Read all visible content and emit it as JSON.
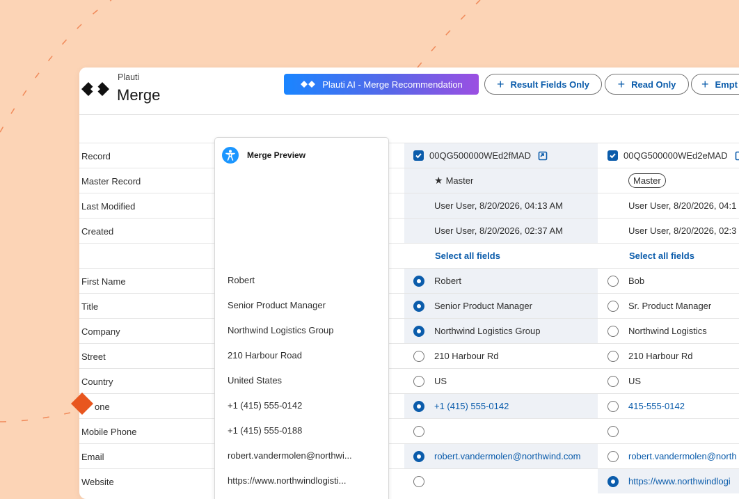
{
  "header": {
    "brand": "Plauti",
    "title": "Merge",
    "ai_button": "Plauti AI - Merge Recommendation",
    "result_fields_button": "Result Fields Only",
    "read_only_button": "Read Only",
    "empty_button": "Empt"
  },
  "preview": {
    "title": "Merge Preview",
    "icon": "accessibility-person-icon",
    "values": {
      "first_name": "Robert",
      "title": "Senior Product Manager",
      "company": "Northwind Logistics Group",
      "street": "210 Harbour Road",
      "country": "United States",
      "phone": "+1 (415) 555-0142",
      "mobile_phone": "+1 (415) 555-0188",
      "email": "robert.vandermolen@northwi...",
      "website": "https://www.northwindlogisti..."
    }
  },
  "labels": {
    "record": "Record",
    "master_record": "Master Record",
    "last_modified": "Last Modified",
    "created": "Created",
    "first_name": "First Name",
    "title": "Title",
    "company": "Company",
    "street": "Street",
    "country": "Country",
    "phone": "one",
    "mobile_phone": "Mobile Phone",
    "email": "Email",
    "website": "Website"
  },
  "records": [
    {
      "id": "00QG500000WEd2fMAD",
      "master_label": "Master",
      "last_modified": "User User, 8/20/2026, 04:13 AM",
      "created": "User User, 8/20/2026, 02:37 AM",
      "select_all": "Select all fields",
      "first_name": "Robert",
      "title": "Senior Product Manager",
      "company": "Northwind Logistics Group",
      "street": "210 Harbour Rd",
      "country": "US",
      "phone": "+1 (415) 555-0142",
      "mobile_phone": "",
      "email": "robert.vandermolen@northwind.com",
      "website": ""
    },
    {
      "id": "00QG500000WEd2eMAD",
      "master_label": "Master",
      "last_modified": "User User, 8/20/2026, 04:1",
      "created": "User User, 8/20/2026, 02:3",
      "select_all": "Select all fields",
      "first_name": "Bob",
      "title": "Sr. Product Manager",
      "company": "Northwind Logistics",
      "street": "210 Harbour Rd",
      "country": "US",
      "phone": "415-555-0142",
      "mobile_phone": "",
      "email": "robert.vandermolen@north",
      "website": "https://www.northwindlogi"
    }
  ],
  "colors": {
    "background": "#fcd4b6",
    "accent": "#0b5cab",
    "selected_row": "#eef1f6",
    "marker": "#e8561f"
  }
}
